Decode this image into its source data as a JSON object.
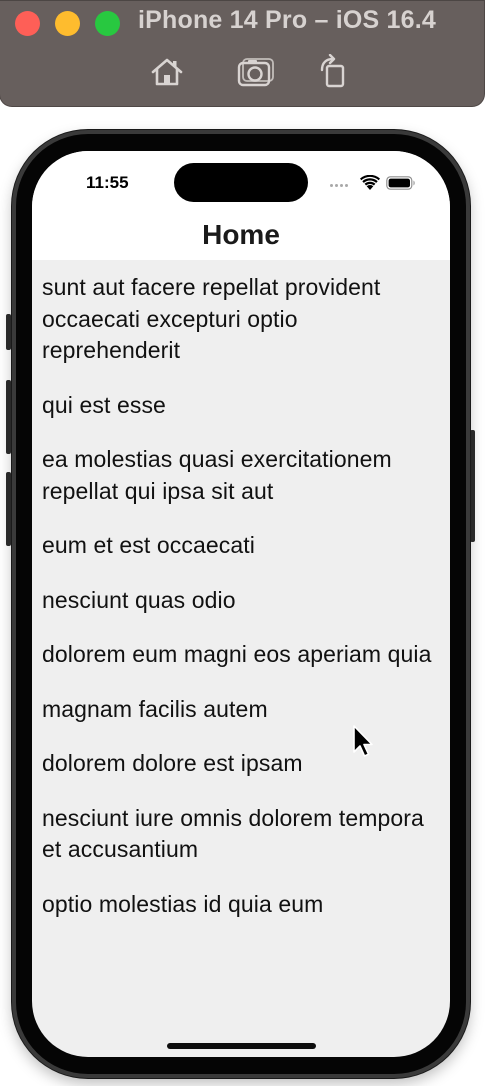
{
  "simulator": {
    "title": "iPhone 14 Pro – iOS 16.4",
    "toolbar": {
      "home_icon": "home-icon",
      "screenshot_icon": "camera-icon",
      "rotate_icon": "rotate-icon"
    },
    "colors": {
      "bar": "#675f5d",
      "close": "#fe5f57",
      "minimize": "#febc2e",
      "zoom": "#28c840"
    }
  },
  "status_bar": {
    "time": "11:55",
    "wifi_icon": "wifi-icon",
    "battery_icon": "battery-icon"
  },
  "navigation": {
    "title": "Home"
  },
  "list": {
    "items": [
      "sunt aut facere repellat provident occaecati excepturi optio reprehenderit",
      "qui est esse",
      "ea molestias quasi exercitationem repellat qui ipsa sit aut",
      "eum et est occaecati",
      "nesciunt quas odio",
      "dolorem eum magni eos aperiam quia",
      "magnam facilis autem",
      "dolorem dolore est ipsam",
      "nesciunt iure omnis dolorem tempora et accusantium",
      "optio molestias id quia eum"
    ]
  },
  "colors": {
    "list_background": "#efefef",
    "nav_background": "#ffffff",
    "text": "#111111"
  }
}
